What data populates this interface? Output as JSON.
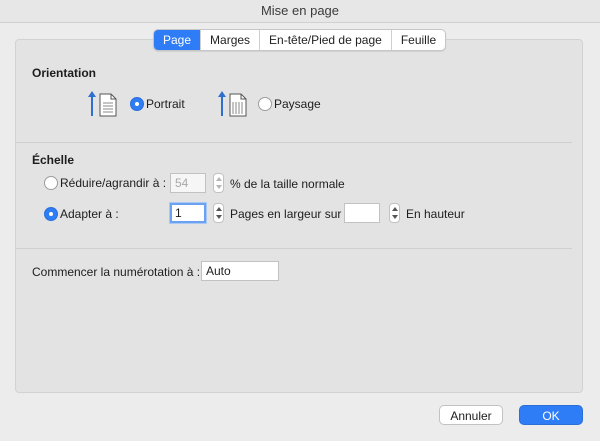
{
  "window": {
    "title": "Mise en page"
  },
  "tabs": [
    {
      "label": "Page",
      "active": true
    },
    {
      "label": "Marges",
      "active": false
    },
    {
      "label": "En-tête/Pied de page",
      "active": false
    },
    {
      "label": "Feuille",
      "active": false
    }
  ],
  "orientation": {
    "title": "Orientation",
    "portrait_label": "Portrait",
    "landscape_label": "Paysage",
    "selected": "Portrait"
  },
  "scale": {
    "title": "Échelle",
    "reduce_label": "Réduire/agrandir à :",
    "reduce_value": "54",
    "reduce_suffix": "% de la taille normale",
    "fit_label": "Adapter à :",
    "fit_wide_value": "1",
    "fit_wide_suffix": "Pages en largeur sur",
    "fit_tall_value": "",
    "fit_tall_suffix": "En hauteur",
    "selected": "Adapter à :"
  },
  "numbering": {
    "label": "Commencer la numérotation à :",
    "value": "Auto"
  },
  "buttons": {
    "cancel": "Annuler",
    "ok": "OK"
  },
  "colors": {
    "accent": "#2f7df6",
    "background": "#ececec"
  },
  "icons": {
    "portrait": "portrait-page-icon",
    "landscape": "landscape-page-icon",
    "stepper": "stepper-icon"
  }
}
